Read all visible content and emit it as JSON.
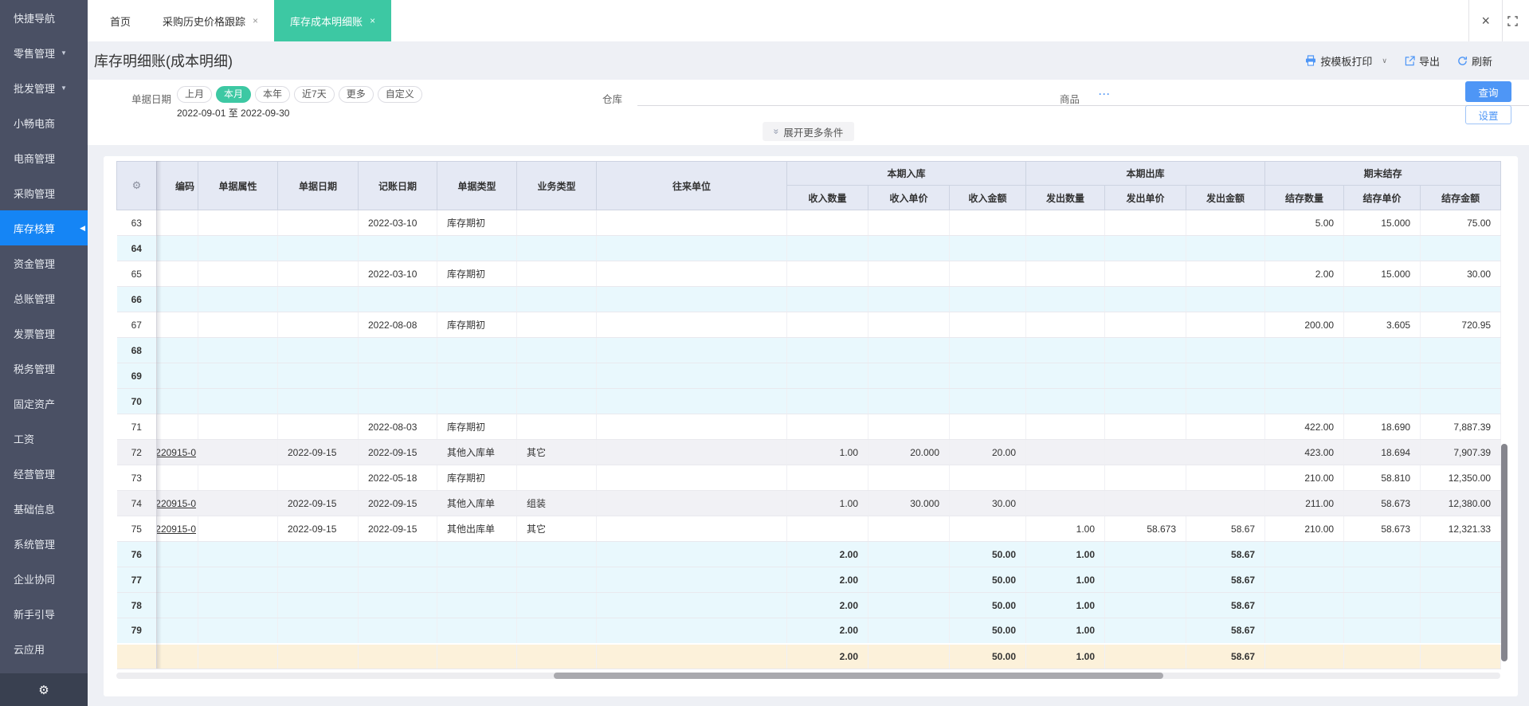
{
  "icons": {
    "settings": "⚙",
    "close": "×",
    "dropdown": "▼",
    "active_arrow": "◀",
    "chevron_down": "∨",
    "more": "···",
    "expand": "»"
  },
  "colors": {
    "accent_blue": "#4e96f6",
    "accent_green": "#3dc8a3",
    "sidebar_active_blue": "#1585f5",
    "subtotal_row": "#e9f8fd",
    "footer_row": "#fcf1da"
  },
  "sidebar": {
    "items": [
      {
        "label": "快捷导航"
      },
      {
        "label": "零售管理",
        "dropdown": true
      },
      {
        "label": "批发管理",
        "dropdown": true
      },
      {
        "label": "小畅电商"
      },
      {
        "label": "电商管理"
      },
      {
        "label": "采购管理"
      },
      {
        "label": "库存核算",
        "active": true
      },
      {
        "label": "资金管理"
      },
      {
        "label": "总账管理"
      },
      {
        "label": "发票管理"
      },
      {
        "label": "税务管理"
      },
      {
        "label": "固定资产"
      },
      {
        "label": "工资"
      },
      {
        "label": "经营管理"
      },
      {
        "label": "基础信息"
      },
      {
        "label": "系统管理"
      },
      {
        "label": "企业协同"
      },
      {
        "label": "新手引导"
      },
      {
        "label": "云应用"
      }
    ]
  },
  "tabs": [
    {
      "label": "首页",
      "closable": false,
      "active": false
    },
    {
      "label": "采购历史价格跟踪",
      "closable": true,
      "active": false
    },
    {
      "label": "库存成本明细账",
      "closable": true,
      "active": true
    }
  ],
  "page": {
    "title": "库存明细账(成本明细)"
  },
  "toolbar": {
    "print": "按模板打印",
    "export": "导出",
    "refresh": "刷新"
  },
  "filters": {
    "date_label": "单据日期",
    "date_options": [
      "上月",
      "本月",
      "本年",
      "近7天",
      "更多",
      "自定义"
    ],
    "date_selected": "本月",
    "date_range": "2022-09-01 至 2022-09-30",
    "warehouse_label": "仓库",
    "product_label": "商品",
    "expand_more": "展开更多条件",
    "query": "查询",
    "settings": "设置"
  },
  "table": {
    "left_headers": [
      "编码",
      "单据属性",
      "单据日期",
      "记账日期",
      "单据类型",
      "业务类型",
      "往来单位"
    ],
    "groups": [
      {
        "label": "本期入库",
        "columns": [
          "收入数量",
          "收入单价",
          "收入金额"
        ]
      },
      {
        "label": "本期出库",
        "columns": [
          "发出数量",
          "发出单价",
          "发出金额"
        ]
      },
      {
        "label": "期末结存",
        "columns": [
          "结存数量",
          "结存单价",
          "结存金额"
        ]
      }
    ],
    "rows": [
      {
        "num": "63",
        "acctDate": "2022-03-10",
        "docType": "库存期初",
        "balQty": "5.00",
        "balPrice": "15.000",
        "balAmt": "75.00",
        "type": "normal"
      },
      {
        "num": "64",
        "type": "subtotal"
      },
      {
        "num": "65",
        "acctDate": "2022-03-10",
        "docType": "库存期初",
        "balQty": "2.00",
        "balPrice": "15.000",
        "balAmt": "30.00",
        "type": "normal"
      },
      {
        "num": "66",
        "type": "subtotal"
      },
      {
        "num": "67",
        "acctDate": "2022-08-08",
        "docType": "库存期初",
        "balQty": "200.00",
        "balPrice": "3.605",
        "balAmt": "720.95",
        "type": "normal"
      },
      {
        "num": "68",
        "type": "subtotal"
      },
      {
        "num": "69",
        "type": "subtotal"
      },
      {
        "num": "70",
        "type": "subtotal"
      },
      {
        "num": "71",
        "acctDate": "2022-08-03",
        "docType": "库存期初",
        "balQty": "422.00",
        "balPrice": "18.690",
        "balAmt": "7,887.39",
        "type": "normal"
      },
      {
        "num": "72",
        "code": "220915-0",
        "docDate": "2022-09-15",
        "acctDate": "2022-09-15",
        "docType": "其他入库单",
        "bizType": "其它",
        "inQty": "1.00",
        "inPrice": "20.000",
        "inAmt": "20.00",
        "balQty": "423.00",
        "balPrice": "18.694",
        "balAmt": "7,907.39",
        "type": "gray"
      },
      {
        "num": "73",
        "acctDate": "2022-05-18",
        "docType": "库存期初",
        "balQty": "210.00",
        "balPrice": "58.810",
        "balAmt": "12,350.00",
        "type": "normal"
      },
      {
        "num": "74",
        "code": "220915-0",
        "docDate": "2022-09-15",
        "acctDate": "2022-09-15",
        "docType": "其他入库单",
        "bizType": "组装",
        "inQty": "1.00",
        "inPrice": "30.000",
        "inAmt": "30.00",
        "balQty": "211.00",
        "balPrice": "58.673",
        "balAmt": "12,380.00",
        "type": "gray"
      },
      {
        "num": "75",
        "code": "220915-0",
        "docDate": "2022-09-15",
        "acctDate": "2022-09-15",
        "docType": "其他出库单",
        "bizType": "其它",
        "outQty": "1.00",
        "outPrice": "58.673",
        "outAmt": "58.67",
        "balQty": "210.00",
        "balPrice": "58.673",
        "balAmt": "12,321.33",
        "type": "normal"
      },
      {
        "num": "76",
        "inQty": "2.00",
        "inAmt": "50.00",
        "outQty": "1.00",
        "outAmt": "58.67",
        "type": "subtotal"
      },
      {
        "num": "77",
        "inQty": "2.00",
        "inAmt": "50.00",
        "outQty": "1.00",
        "outAmt": "58.67",
        "type": "subtotal"
      },
      {
        "num": "78",
        "inQty": "2.00",
        "inAmt": "50.00",
        "outQty": "1.00",
        "outAmt": "58.67",
        "type": "subtotal"
      },
      {
        "num": "79",
        "inQty": "2.00",
        "inAmt": "50.00",
        "outQty": "1.00",
        "outAmt": "58.67",
        "type": "subtotal"
      }
    ],
    "footer": {
      "num": "",
      "inQty": "2.00",
      "inAmt": "50.00",
      "outQty": "1.00",
      "outAmt": "58.67"
    }
  }
}
